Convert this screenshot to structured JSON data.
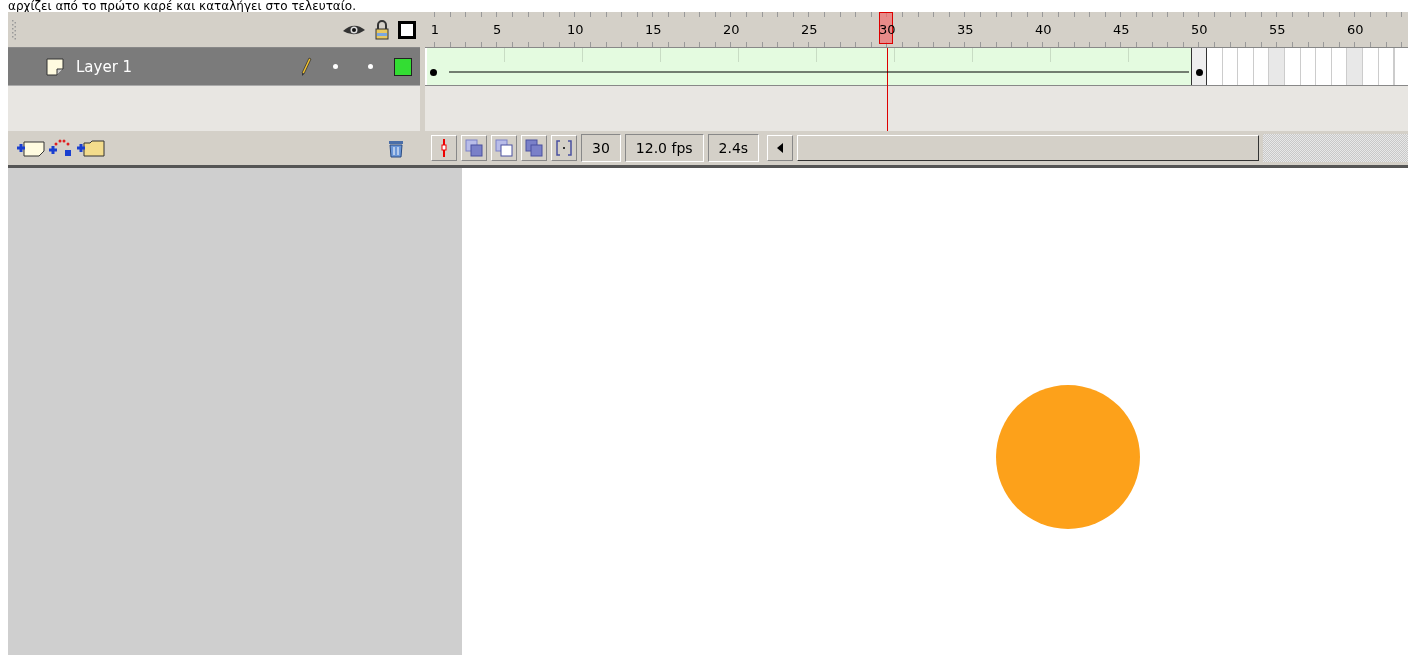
{
  "caption": "αρχίζει από το πρώτο καρέ και καταλήγει στο τελευταίο.",
  "timeline": {
    "ruler_labels": [
      {
        "label": "1",
        "keyframe": true
      },
      {
        "label": "5",
        "keyframe": false
      },
      {
        "label": "10",
        "keyframe": false
      },
      {
        "label": "15",
        "keyframe": false
      },
      {
        "label": "20",
        "keyframe": false
      },
      {
        "label": "25",
        "keyframe": false
      },
      {
        "label": "30",
        "keyframe": false
      },
      {
        "label": "35",
        "keyframe": false
      },
      {
        "label": "40",
        "keyframe": false
      },
      {
        "label": "45",
        "keyframe": false
      },
      {
        "label": "50",
        "keyframe": true
      },
      {
        "label": "55",
        "keyframe": false
      },
      {
        "label": "60",
        "keyframe": false
      }
    ],
    "layers": [
      {
        "name": "Layer 1",
        "selected": true,
        "color": "#33dd33"
      }
    ],
    "status": {
      "frame": "30",
      "fps": "12.0 fps",
      "time": "2.4s"
    }
  }
}
